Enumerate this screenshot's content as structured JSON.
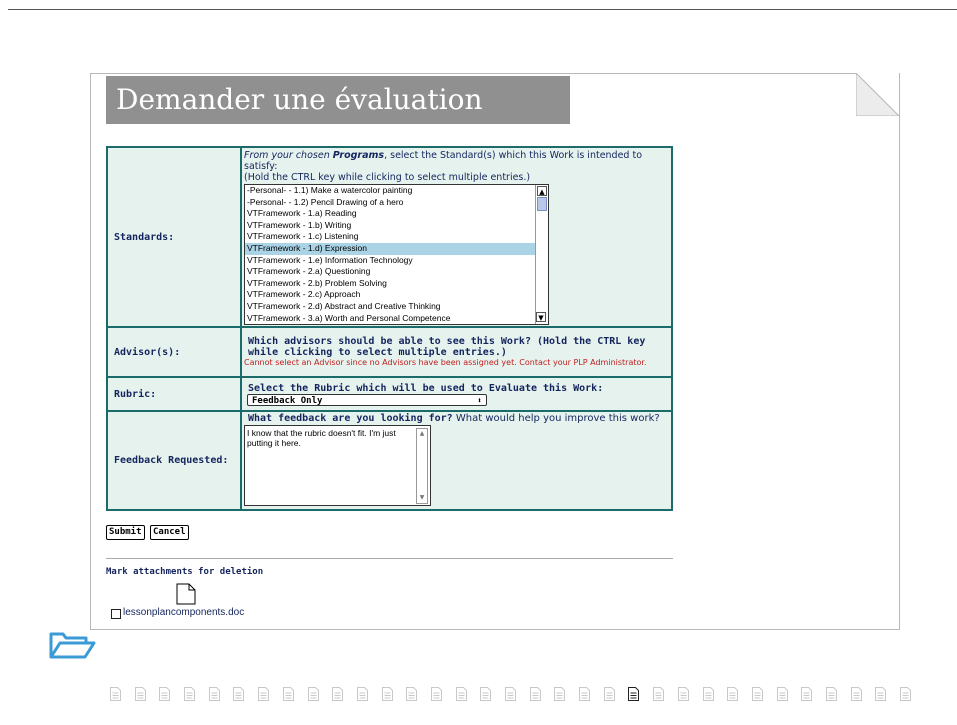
{
  "page": {
    "title": "Demander une évaluation"
  },
  "standards": {
    "label": "Standards:",
    "intro_prefix": "From your chosen ",
    "intro_programs": "Programs",
    "intro_suffix": ", select the Standard(s) which this Work is intended to satisfy:",
    "hint": "(Hold the CTRL key while clicking to select multiple entries.)",
    "options": [
      "-Personal- - 1.1) Make a watercolor painting",
      "-Personal- - 1.2) Pencil Drawing of a hero",
      "VTFramework - 1.a) Reading",
      "VTFramework - 1.b) Writing",
      "VTFramework - 1.c) Listening",
      "VTFramework - 1.d) Expression",
      "VTFramework - 1.e) Information Technology",
      "VTFramework - 2.a) Questioning",
      "VTFramework - 2.b) Problem Solving",
      "VTFramework - 2.c) Approach",
      "VTFramework - 2.d) Abstract and Creative Thinking",
      "VTFramework - 3.a) Worth and Personal Competence"
    ],
    "selected": "VTFramework - 1.d) Expression"
  },
  "advisors": {
    "label": "Advisor(s):",
    "question": "Which advisors should be able to see this Work? (Hold the CTRL key while clicking to select multiple entries.)",
    "error": "Cannot select an Advisor since no Advisors have been assigned yet. Contact your PLP Administrator."
  },
  "rubric": {
    "label": "Rubric:",
    "question": "Select the Rubric which will be used to Evaluate this Work:",
    "selected": "Feedback Only"
  },
  "feedback": {
    "label": "Feedback Requested:",
    "question_bold": "What feedback are you looking for?",
    "question_rest": " What would help you improve this work?",
    "value": "I know that the rubric doesn't fit. I'm just putting it here."
  },
  "buttons": {
    "submit": "Submit",
    "cancel": "Cancel"
  },
  "attachments": {
    "heading": "Mark attachments for deletion",
    "file": "lessonplancomponents.doc"
  },
  "pager": {
    "count": 33,
    "current": 22
  },
  "colors": {
    "banner": "#909090",
    "table_border": "#1c6b6b",
    "table_bg": "#e6f2ee",
    "label_text": "#14255e",
    "error_text": "#c02020",
    "selected_option": "#aad4e6",
    "folder_icon": "#3b9bd6"
  },
  "icons": [
    "page-fold-icon",
    "document-icon",
    "folder-icon",
    "page-icon"
  ]
}
